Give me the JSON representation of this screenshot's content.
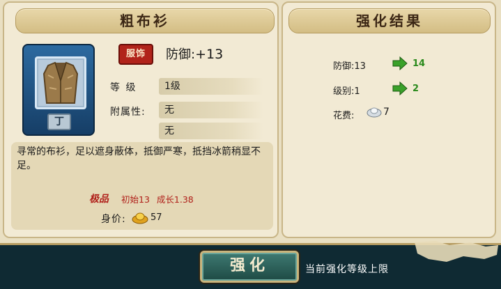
{
  "item": {
    "name": "粗布衫",
    "type_badge": "服饰",
    "grade_tag": "丁",
    "defense_label": "防御:",
    "defense_value": "+13",
    "level_label": "等  级",
    "level_value": "1级",
    "attached_label": "附属性:",
    "attached_values": [
      "无",
      "无"
    ],
    "description": "寻常的布衫，足以遮身蔽体，抵御严寒，抵挡冰箭稍显不足。",
    "quality_label": "极品",
    "initial": "初始13",
    "growth": "成长1.38",
    "price_label": "身价:",
    "price_value": "57",
    "icons": [
      "garment-vest-icon",
      "gold-ingot-icon"
    ]
  },
  "result": {
    "title": "强化结果",
    "defense_old": "防御:13",
    "defense_new": "14",
    "level_old": "级别:1",
    "level_new": "2",
    "cost_label": "花费:",
    "cost_value": "7",
    "icons": [
      "green-arrow-icon",
      "silver-ingot-icon"
    ]
  },
  "footer": {
    "enhance_button": "强化",
    "status_text": "当前强化等级上限"
  },
  "colors": {
    "panel_bg": "#f2ead4",
    "title_bar": "#d9c48e",
    "badge_red": "#b1231a",
    "green_value": "#2a8a1c",
    "quality_red": "#b0201a",
    "button_teal": "#2d625b"
  }
}
